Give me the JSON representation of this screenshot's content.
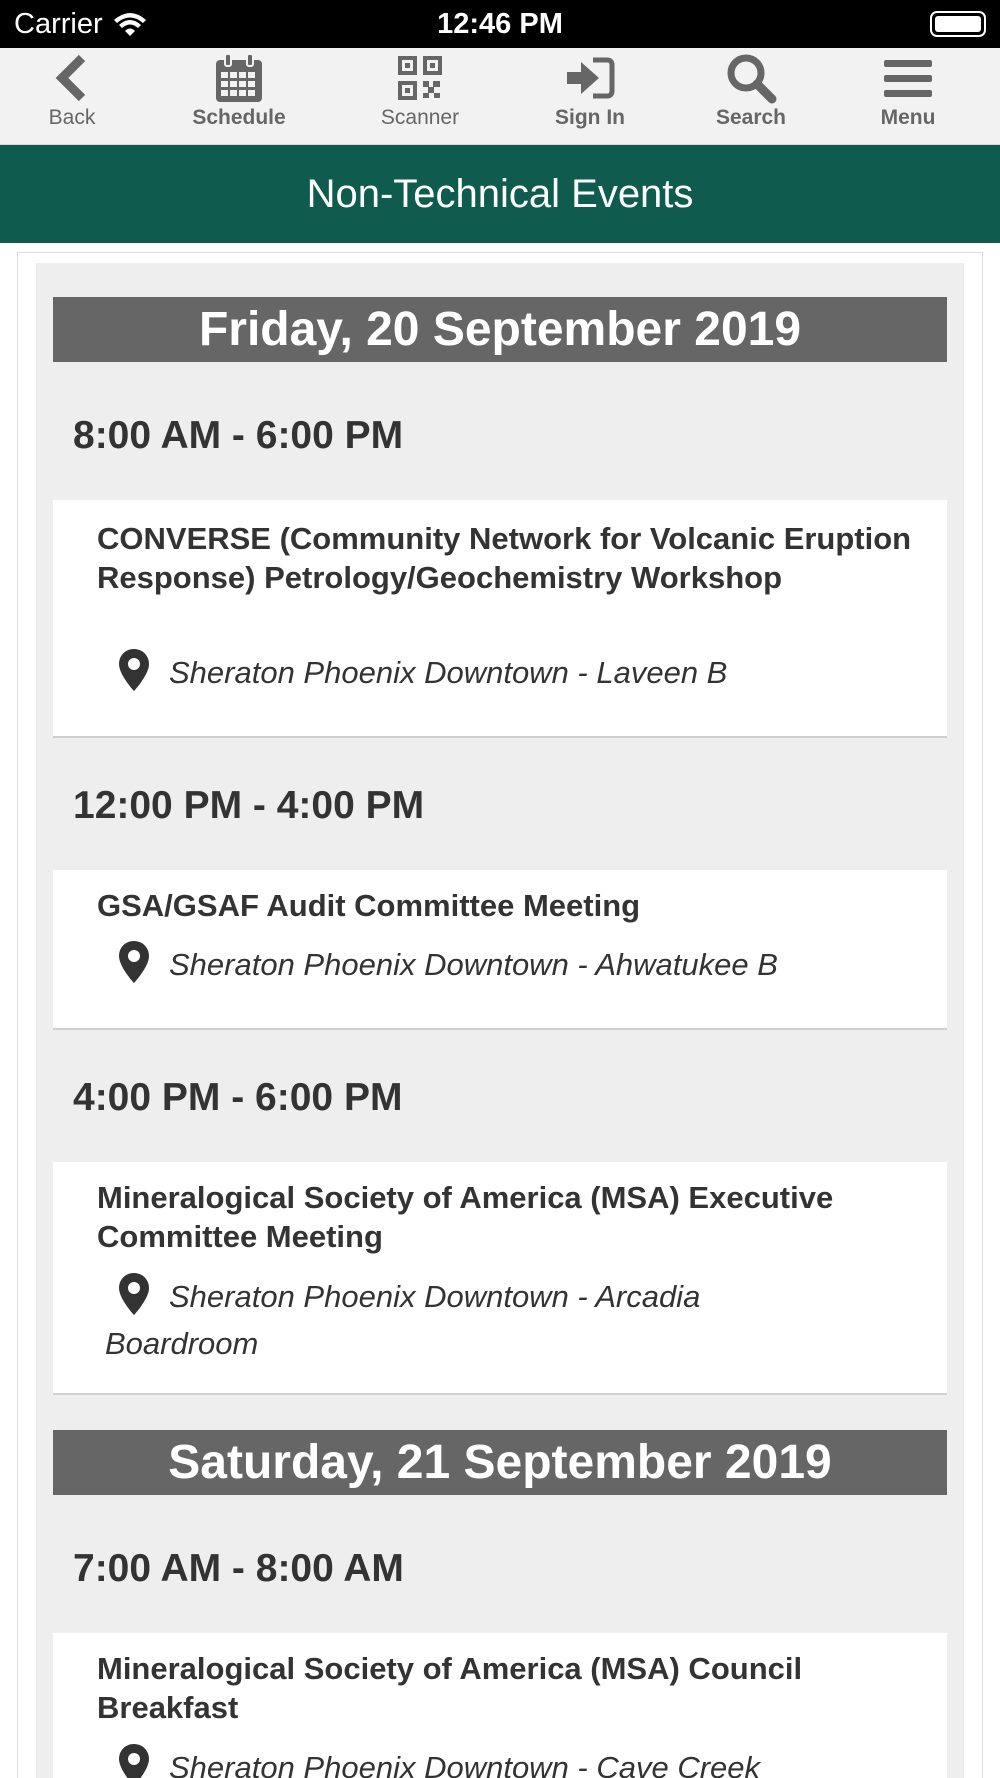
{
  "status_bar": {
    "carrier": "Carrier",
    "time": "12:46 PM"
  },
  "nav": {
    "items": [
      {
        "label": "Back",
        "icon": "chevron-left-icon"
      },
      {
        "label": "Schedule",
        "icon": "calendar-icon"
      },
      {
        "label": "Scanner",
        "icon": "qr-code-icon"
      },
      {
        "label": "Sign In",
        "icon": "sign-in-icon"
      },
      {
        "label": "Search",
        "icon": "search-icon"
      },
      {
        "label": "Menu",
        "icon": "hamburger-menu-icon"
      }
    ]
  },
  "page_title": "Non-Technical Events",
  "colors": {
    "header_green": "#0f5c4e",
    "day_header_gray": "#666666",
    "content_background": "#eeeeee"
  },
  "days": [
    {
      "date": "Friday, 20 September 2019",
      "slots": [
        {
          "time": "8:00 AM - 6:00 PM",
          "event": {
            "title": "CONVERSE (Community Network for Volcanic Eruption Response) Petrology/Geochemistry Workshop",
            "location": "Sheraton Phoenix Downtown - Laveen B"
          }
        },
        {
          "time": "12:00 PM - 4:00 PM",
          "event": {
            "title": "GSA/GSAF Audit Committee Meeting",
            "location": "Sheraton Phoenix Downtown - Ahwatukee B"
          }
        },
        {
          "time": "4:00 PM - 6:00 PM",
          "event": {
            "title": "Mineralogical Society of America (MSA) Executive Committee Meeting",
            "location": "Sheraton Phoenix Downtown - Arcadia Boardroom"
          }
        }
      ]
    },
    {
      "date": "Saturday, 21 September 2019",
      "slots": [
        {
          "time": "7:00 AM - 8:00 AM",
          "event": {
            "title": "Mineralogical Society of America (MSA) Council Breakfast",
            "location": "Sheraton Phoenix Downtown - Cave Creek"
          }
        }
      ]
    }
  ]
}
